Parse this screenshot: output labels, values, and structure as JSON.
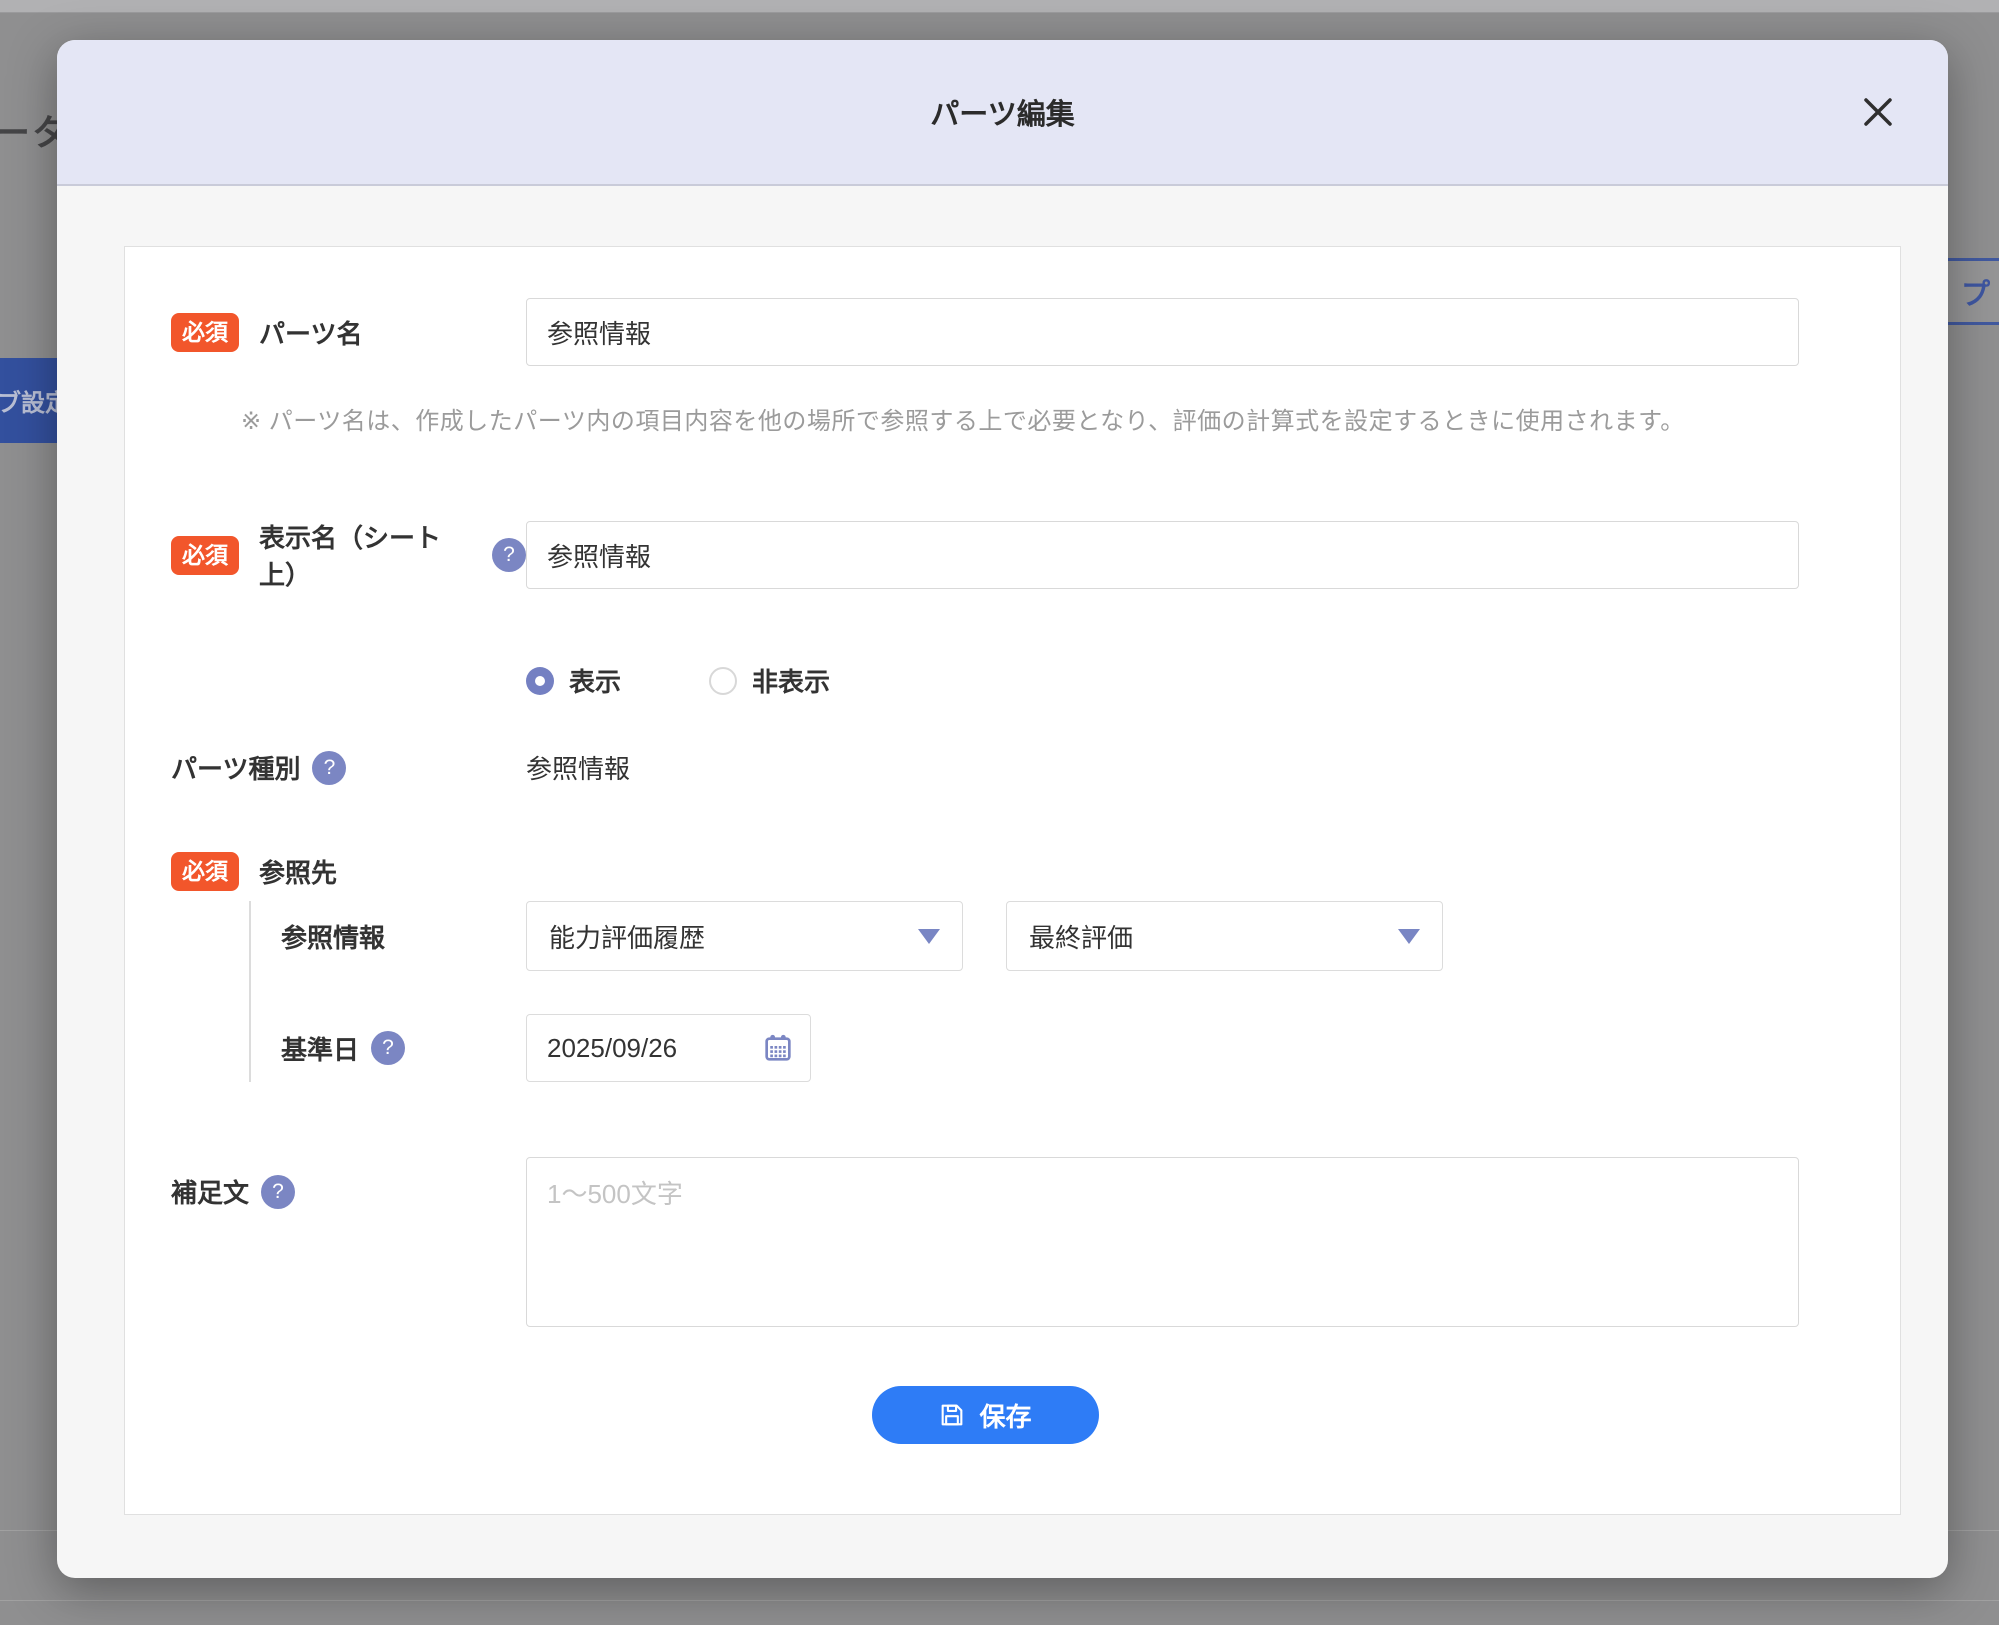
{
  "background": {
    "left_text": "ータ",
    "left_tab_label": "ブ設定",
    "right_button_label": "プ"
  },
  "modal": {
    "title": "パーツ編集",
    "required_badge": "必須",
    "fields": {
      "parts_name": {
        "label": "パーツ名",
        "value": "参照情報",
        "note": "※ パーツ名は、作成したパーツ内の項目内容を他の場所で参照する上で必要となり、評価の計算式を設定するときに使用されます。"
      },
      "display_name": {
        "label": "表示名（シート上）",
        "value": "参照情報"
      },
      "visibility": {
        "options": [
          {
            "label": "表示",
            "selected": true
          },
          {
            "label": "非表示",
            "selected": false
          }
        ]
      },
      "parts_type": {
        "label": "パーツ種別",
        "value": "参照情報"
      },
      "reference": {
        "label": "参照先",
        "sub_label": "参照情報",
        "dropdown1_value": "能力評価履歴",
        "dropdown2_value": "最終評価",
        "base_date_label": "基準日",
        "base_date_value": "2025/09/26"
      },
      "supplement": {
        "label": "補足文",
        "placeholder": "1〜500文字"
      }
    },
    "save_button": "保存"
  },
  "colors": {
    "required_badge": "#f2562b",
    "help_icon": "#7b86c3",
    "accent_blue": "#2e7cf6",
    "header_bg": "#e4e6f5",
    "radio_selected": "#7480c2"
  }
}
